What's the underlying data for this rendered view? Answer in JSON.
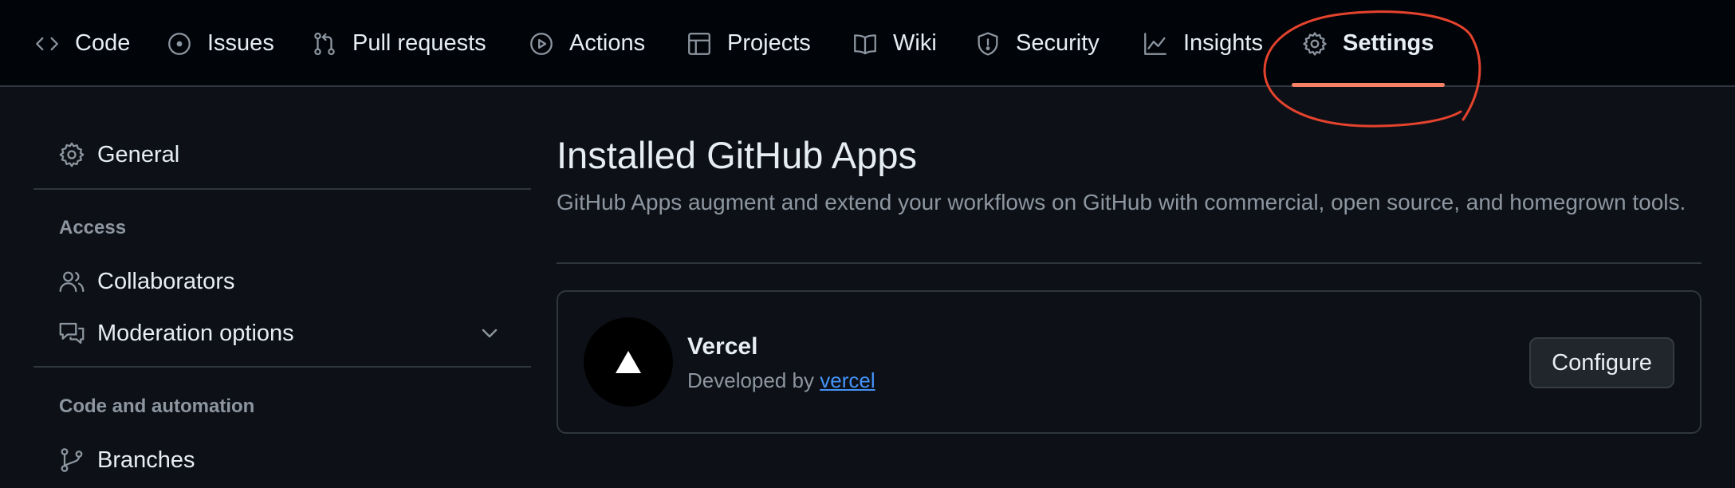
{
  "tabs": [
    {
      "label": "Code",
      "icon": "code-icon"
    },
    {
      "label": "Issues",
      "icon": "issue-icon"
    },
    {
      "label": "Pull requests",
      "icon": "pull-request-icon"
    },
    {
      "label": "Actions",
      "icon": "play-icon"
    },
    {
      "label": "Projects",
      "icon": "table-icon"
    },
    {
      "label": "Wiki",
      "icon": "book-icon"
    },
    {
      "label": "Security",
      "icon": "shield-icon"
    },
    {
      "label": "Insights",
      "icon": "graph-icon"
    },
    {
      "label": "Settings",
      "icon": "gear-icon",
      "active": true
    }
  ],
  "sidebar": {
    "general": "General",
    "access_heading": "Access",
    "collaborators": "Collaborators",
    "moderation": "Moderation options",
    "code_heading": "Code and automation",
    "branches": "Branches"
  },
  "main": {
    "title": "Installed GitHub Apps",
    "description": "GitHub Apps augment and extend your workflows on GitHub with commercial, open source, and homegrown tools.",
    "app": {
      "name": "Vercel",
      "developed_by": "Developed by",
      "developer": "vercel",
      "configure_label": "Configure"
    }
  },
  "colors": {
    "accent": "#f78166",
    "annotation": "#e5432d",
    "link": "#4493f8"
  }
}
